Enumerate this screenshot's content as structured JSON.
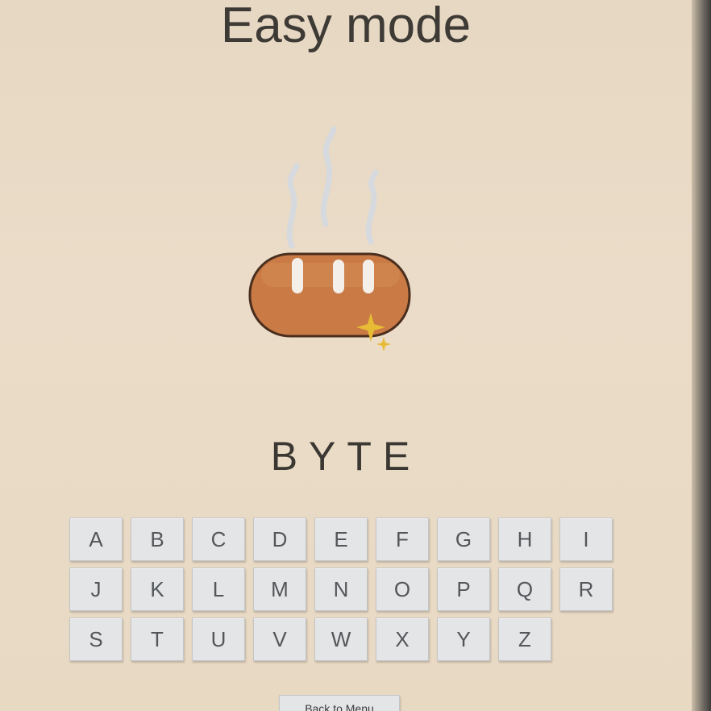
{
  "header": {
    "title": "Easy mode"
  },
  "illustration": {
    "icon": "steaming-bread-icon"
  },
  "game": {
    "word": "BYTE"
  },
  "keyboard": {
    "rows": [
      [
        "A",
        "B",
        "C",
        "D",
        "E",
        "F",
        "G",
        "H",
        "I"
      ],
      [
        "J",
        "K",
        "L",
        "M",
        "N",
        "O",
        "P",
        "Q",
        "R"
      ],
      [
        "S",
        "T",
        "U",
        "V",
        "W",
        "X",
        "Y",
        "Z"
      ]
    ]
  },
  "footer": {
    "back_label": "Back to Menu"
  },
  "colors": {
    "background": "#e9dbc6",
    "bread": "#c97a45",
    "sparkle": "#e8bb34",
    "key": "#e4e5e6"
  }
}
